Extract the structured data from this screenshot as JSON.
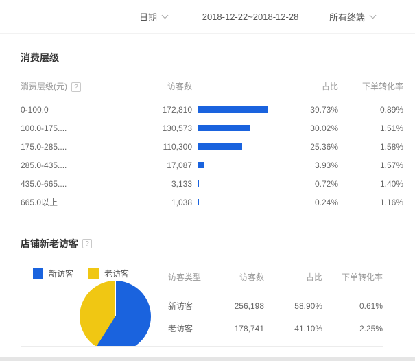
{
  "toolbar": {
    "date_label": "日期",
    "date_range": "2018-12-22~2018-12-28",
    "terminal_label": "所有终端"
  },
  "colors": {
    "bar_fill": "#1a63de",
    "bar_track": "#f3f3f3",
    "accent_blue": "#1a63de",
    "accent_yellow": "#f0c713"
  },
  "consumption": {
    "title": "消费层级",
    "help_icon": "?",
    "columns": {
      "level": "消费层级(元)",
      "visitors": "访客数",
      "share": "占比",
      "conversion": "下单转化率"
    },
    "rows": [
      {
        "label": "0-100.0",
        "visitors": "172,810",
        "bar_pct": 100,
        "share": "39.73%",
        "conversion": "0.89%"
      },
      {
        "label": "100.0-175....",
        "visitors": "130,573",
        "bar_pct": 75.6,
        "share": "30.02%",
        "conversion": "1.51%"
      },
      {
        "label": "175.0-285....",
        "visitors": "110,300",
        "bar_pct": 63.8,
        "share": "25.36%",
        "conversion": "1.58%"
      },
      {
        "label": "285.0-435....",
        "visitors": "17,087",
        "bar_pct": 9.9,
        "share": "3.93%",
        "conversion": "1.57%"
      },
      {
        "label": "435.0-665....",
        "visitors": "3,133",
        "bar_pct": 1.8,
        "share": "0.72%",
        "conversion": "1.40%"
      },
      {
        "label": "665.0以上",
        "visitors": "1,038",
        "bar_pct": 0.6,
        "share": "0.24%",
        "conversion": "1.16%"
      }
    ]
  },
  "visitors_section": {
    "title": "店铺新老访客",
    "help_icon": "?",
    "legend": [
      {
        "label": "新访客",
        "color": "#1a63de"
      },
      {
        "label": "老访客",
        "color": "#f0c713"
      }
    ],
    "columns": {
      "type": "访客类型",
      "visitors": "访客数",
      "share": "占比",
      "conversion": "下单转化率"
    },
    "rows": [
      {
        "type": "新访客",
        "visitors": "256,198",
        "share": "58.90%",
        "conversion": "0.61%"
      },
      {
        "type": "老访客",
        "visitors": "178,741",
        "share": "41.10%",
        "conversion": "2.25%"
      }
    ],
    "pie": {
      "new_pct": 58.9,
      "old_pct": 41.1,
      "new_color": "#1a63de",
      "old_color": "#f0c713"
    }
  },
  "chart_data": [
    {
      "type": "bar",
      "title": "消费层级",
      "orientation": "horizontal",
      "categories": [
        "0-100.0",
        "100.0-175....",
        "175.0-285....",
        "285.0-435....",
        "435.0-665....",
        "665.0以上"
      ],
      "series": [
        {
          "name": "访客数",
          "values": [
            172810,
            130573,
            110300,
            17087,
            3133,
            1038
          ]
        },
        {
          "name": "占比(%)",
          "values": [
            39.73,
            30.02,
            25.36,
            3.93,
            0.72,
            0.24
          ]
        },
        {
          "name": "下单转化率(%)",
          "values": [
            0.89,
            1.51,
            1.58,
            1.57,
            1.4,
            1.16
          ]
        }
      ],
      "xlabel": "",
      "ylabel": "",
      "legend_position": "none",
      "grid": false
    },
    {
      "type": "pie",
      "title": "店铺新老访客",
      "categories": [
        "新访客",
        "老访客"
      ],
      "values": [
        256198,
        178741
      ],
      "percentages": [
        58.9,
        41.1
      ],
      "conversion_rates": [
        0.61,
        2.25
      ],
      "colors": [
        "#1a63de",
        "#f0c713"
      ],
      "legend_position": "top-left"
    }
  ]
}
